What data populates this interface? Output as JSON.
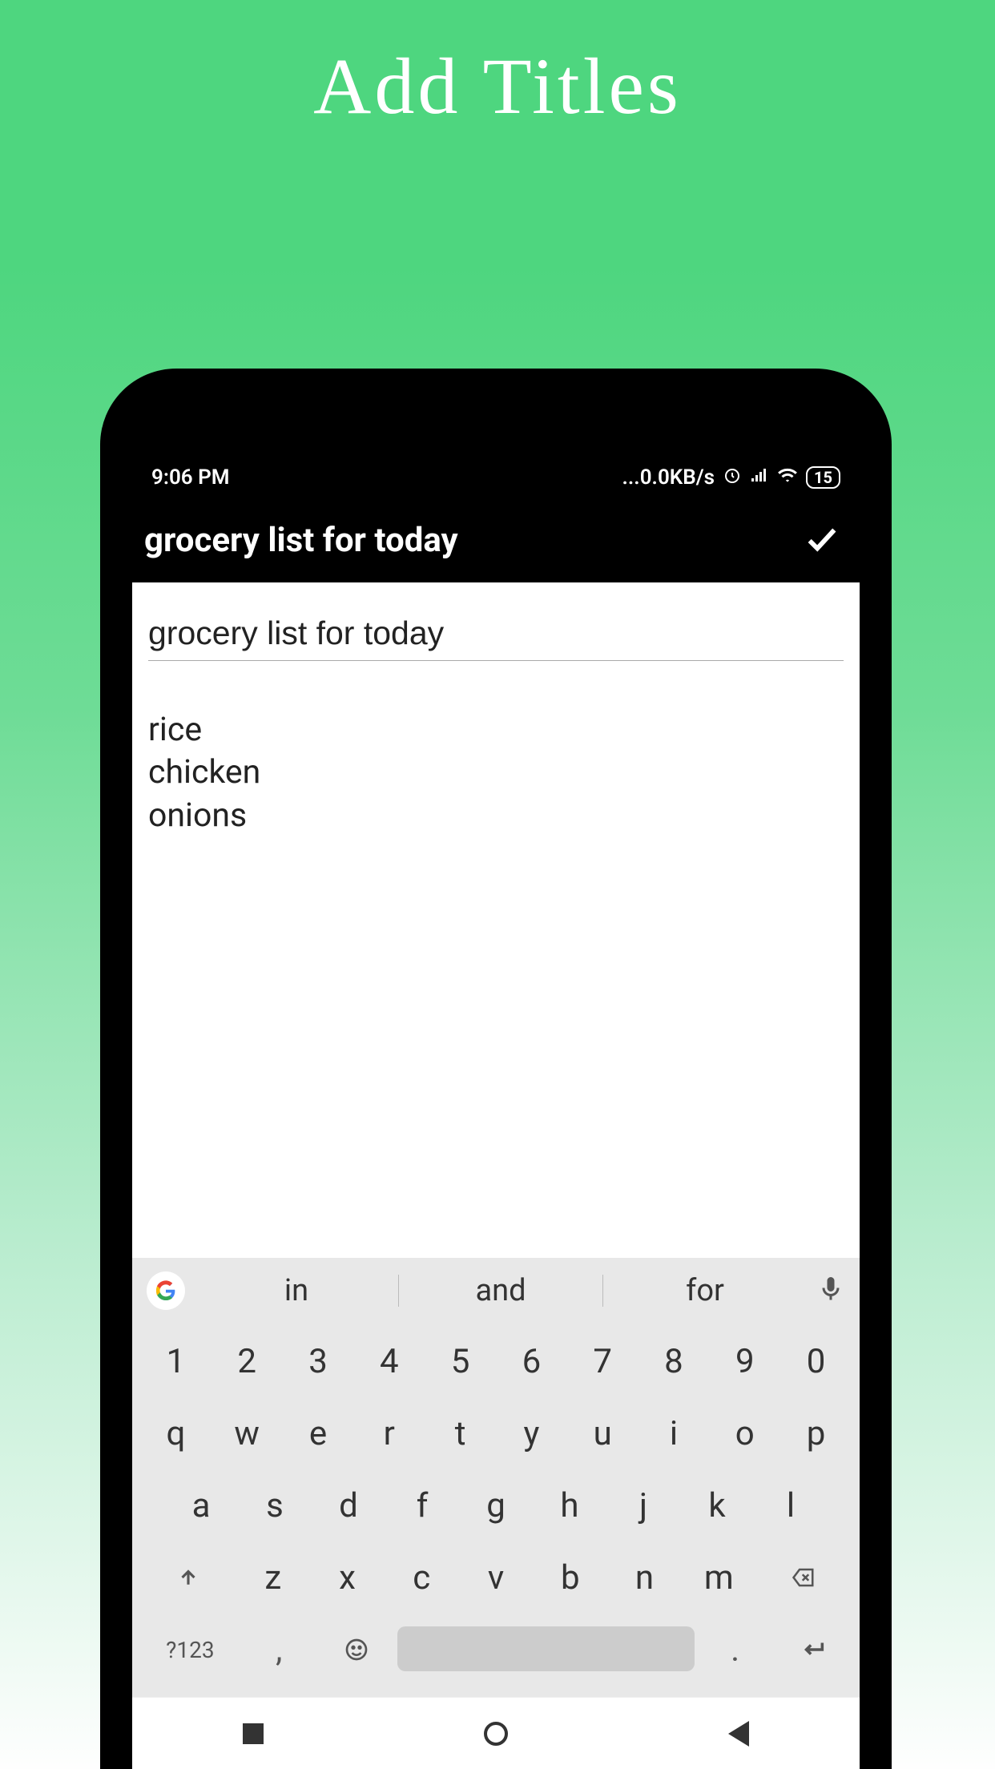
{
  "promo": {
    "title": "Add Titles"
  },
  "statusBar": {
    "time": "9:06 PM",
    "dataRate": "...0.0KB/s",
    "batteryLevel": "15"
  },
  "appHeader": {
    "title": "grocery list for today"
  },
  "note": {
    "titleValue": "grocery list for today",
    "bodyLines": [
      "rice",
      "chicken",
      "onions"
    ]
  },
  "keyboard": {
    "suggestions": [
      "in",
      "and",
      "for"
    ],
    "row1": [
      "1",
      "2",
      "3",
      "4",
      "5",
      "6",
      "7",
      "8",
      "9",
      "0"
    ],
    "row2": [
      "q",
      "w",
      "e",
      "r",
      "t",
      "y",
      "u",
      "i",
      "o",
      "p"
    ],
    "row3": [
      "a",
      "s",
      "d",
      "f",
      "g",
      "h",
      "j",
      "k",
      "l"
    ],
    "row4": [
      "z",
      "x",
      "c",
      "v",
      "b",
      "n",
      "m"
    ],
    "symbolsKey": "?123",
    "commaKey": ",",
    "periodKey": "."
  }
}
